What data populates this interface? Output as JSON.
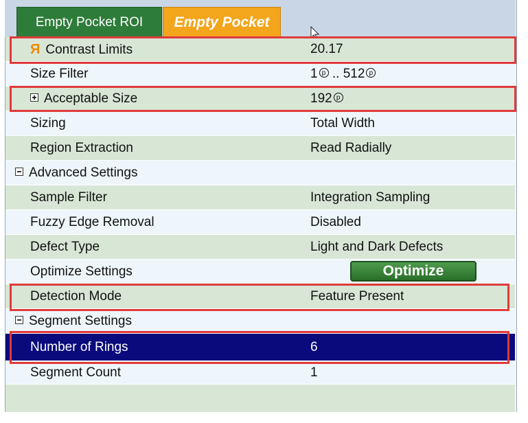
{
  "tabs": [
    {
      "label": "Empty Pocket ROI"
    },
    {
      "label": "Empty Pocket"
    }
  ],
  "rows": {
    "contrast_limits": {
      "label": "Contrast Limits",
      "value": "20.17",
      "icon": "r-icon"
    },
    "size_filter": {
      "label": "Size Filter",
      "min": "1",
      "sep": " .. ",
      "max": "512",
      "unit_symbol": "p"
    },
    "acceptable_size": {
      "label": "Acceptable Size",
      "value": "192",
      "unit_symbol": "p"
    },
    "sizing": {
      "label": "Sizing",
      "value": "Total Width"
    },
    "region_extraction": {
      "label": "Region Extraction",
      "value": "Read Radially"
    },
    "advanced_settings": {
      "label": "Advanced Settings"
    },
    "sample_filter": {
      "label": "Sample Filter",
      "value": "Integration Sampling"
    },
    "fuzzy_edge_removal": {
      "label": "Fuzzy Edge Removal",
      "value": "Disabled"
    },
    "defect_type": {
      "label": "Defect Type",
      "value": "Light and Dark Defects"
    },
    "optimize_settings": {
      "label": "Optimize Settings",
      "button": "Optimize"
    },
    "detection_mode": {
      "label": "Detection Mode",
      "value": "Feature Present"
    },
    "segment_settings": {
      "label": "Segment Settings"
    },
    "number_of_rings": {
      "label": "Number of Rings",
      "value": "6"
    },
    "segment_count": {
      "label": "Segment Count",
      "value": "1"
    }
  },
  "colors": {
    "highlight": "#e03a3a",
    "selected_row": "#0a0a7d",
    "row_green": "#d8e6d6",
    "tab_active": "#f3a51b",
    "tab_inactive": "#2e7c3a"
  }
}
